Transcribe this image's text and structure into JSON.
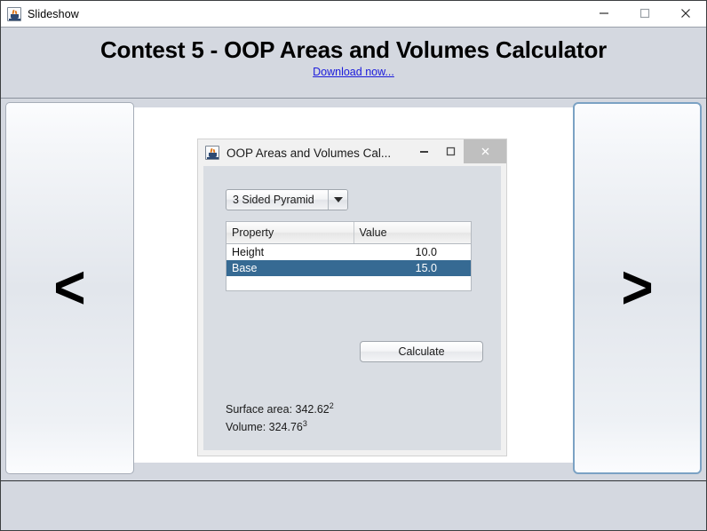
{
  "window": {
    "title": "Slideshow",
    "icon": "java-coffee-cup-icon",
    "controls": {
      "minimize": "minimize-icon",
      "maximize": "maximize-icon",
      "close": "close-icon"
    }
  },
  "header": {
    "title": "Contest 5 - OOP Areas and Volumes Calculator",
    "link_text": "Download now...",
    "link_color": "#1b1bdb"
  },
  "nav": {
    "prev_label": "<",
    "next_label": ">",
    "next_focus_border_color": "#7ba2c4"
  },
  "slide": {
    "app": {
      "title": "OOP Areas and Volumes Cal...",
      "icon": "java-coffee-cup-icon",
      "controls": {
        "minimize": "minimize-icon",
        "maximize": "maximize-icon",
        "close": "close-icon"
      },
      "shape_combo": {
        "selected": "3 Sided Pyramid",
        "arrow": "chevron-down-icon"
      },
      "table": {
        "columns": [
          "Property",
          "Value"
        ],
        "rows": [
          {
            "property": "Height",
            "value": "10.0",
            "selected": false
          },
          {
            "property": "Base",
            "value": "15.0",
            "selected": true
          }
        ],
        "selection_color": "#366a93"
      },
      "calculate_label": "Calculate",
      "results": {
        "surface_area_label": "Surface area: 342.62",
        "surface_area_exponent": "2",
        "volume_label": "Volume: 324.76",
        "volume_exponent": "3"
      }
    }
  }
}
